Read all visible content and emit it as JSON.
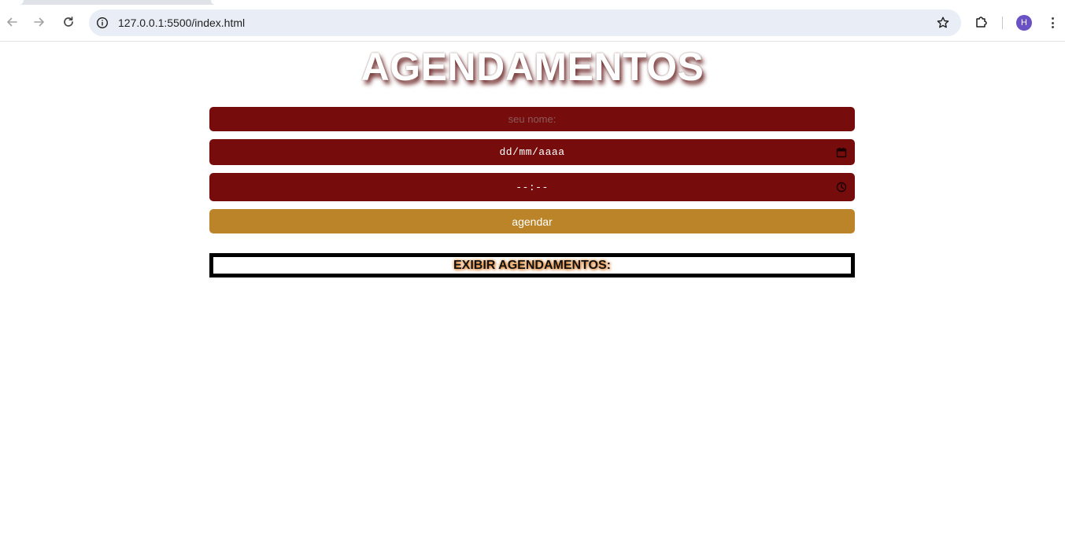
{
  "browser": {
    "url": "127.0.0.1:5500/index.html",
    "profile_initial": "H",
    "icons": [
      "back-icon",
      "forward-icon",
      "reload-icon",
      "info-icon",
      "star-icon",
      "extensions-icon",
      "more-icon"
    ]
  },
  "page": {
    "title": "AGENDAMENTOS",
    "name_placeholder": "seu nome:",
    "date_placeholder": "dd/mm/aaaa",
    "time_placeholder": "--:--",
    "submit_label": "agendar",
    "list_title": "EXIBIR AGENDAMENTOS:"
  },
  "colors": {
    "field_bg": "#760c0c",
    "button_bg": "#bb8428",
    "title_shadow": "#5a0a0a",
    "list_glow": "#e08a2a"
  }
}
